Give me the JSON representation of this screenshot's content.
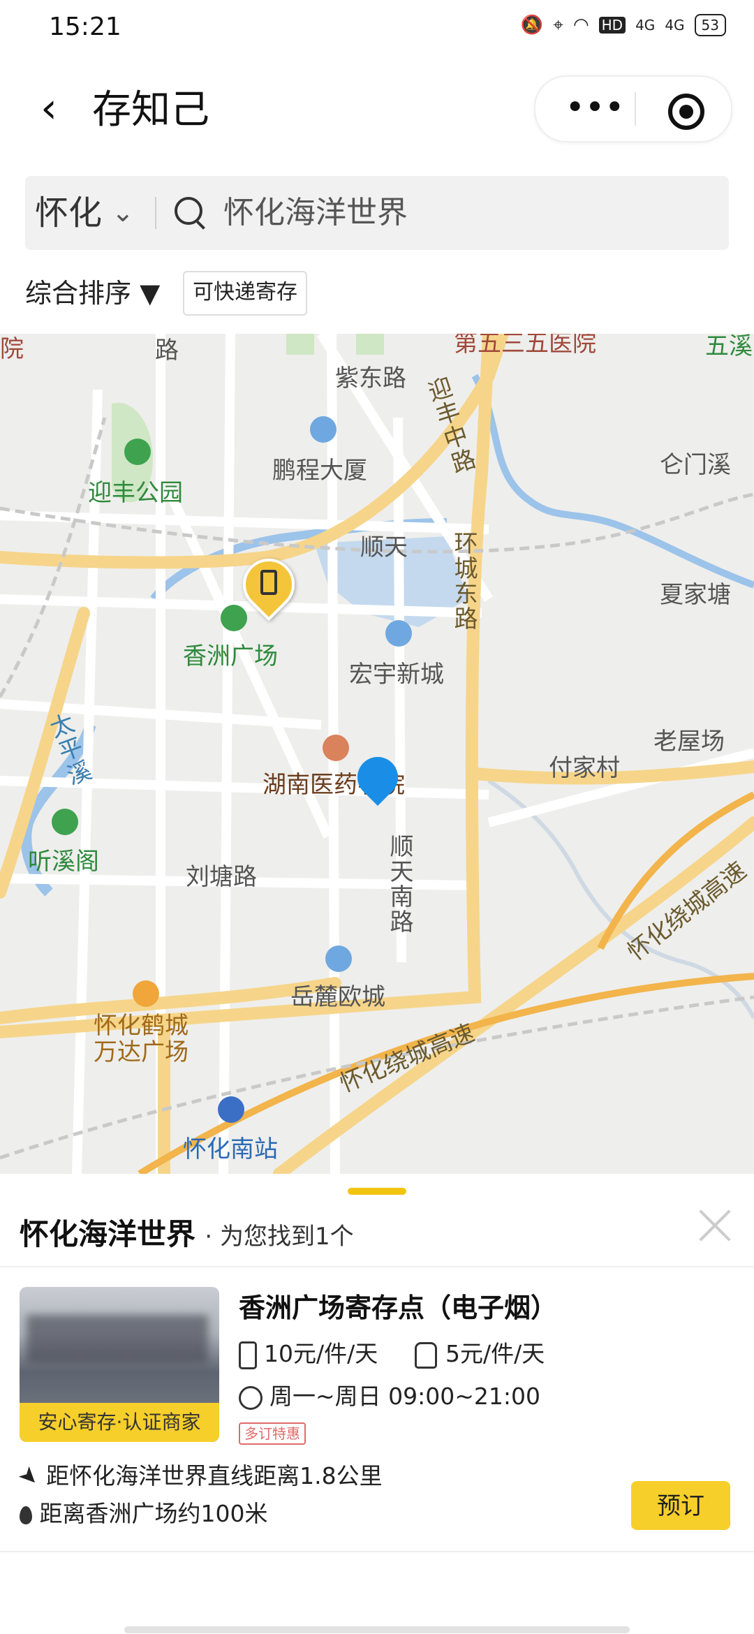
{
  "status_bar": {
    "time": "15:21",
    "net1": "4G",
    "net2": "4G",
    "hd": "HD",
    "battery": "53"
  },
  "header": {
    "back": "‹",
    "title": "存知己",
    "more": "•••"
  },
  "search": {
    "city": "怀化",
    "query": "怀化海洋世界"
  },
  "filters": {
    "sort_label": "综合排序 ▼",
    "tag": "可快递寄存"
  },
  "map": {
    "labels": {
      "zidong_road": "紫东路",
      "pengcheng": "鹏程大厦",
      "yingfeng_park": "迎丰公园",
      "shuntian": "顺天",
      "xiangzhou_square": "香洲广场",
      "hongyu": "宏宇新城",
      "yingfeng_mid_road": "迎丰中路",
      "huancheng_east": "环城东路",
      "cangmenxi": "仑门溪",
      "xiajiatang": "夏家塘",
      "laowuchang": "老屋场",
      "fujiacun": "付家村",
      "hospital": "湖南医药学院",
      "taipingxi": "太平溪",
      "tingxige": "听溪阁",
      "liutang_road": "刘塘路",
      "shuntian_south": "顺天南路",
      "yuelu": "岳麓欧城",
      "wanda": "怀化鹤城万达广场",
      "south_station": "怀化南站",
      "ring_hw1": "怀化绕城高速",
      "ring_hw2": "怀化绕城高速",
      "top_hospital": "第五三五医院",
      "top_road": "路",
      "top_left": "院",
      "top_right": "五溪"
    }
  },
  "sheet": {
    "keyword": "怀化海洋世界",
    "found_text": "· 为您找到1个",
    "shop": {
      "name": "香洲广场寄存点（电子烟）",
      "badge": "安心寄存·认证商家",
      "price_luggage": "10元/件/天",
      "price_bag": "5元/件/天",
      "hours": "周一~周日 09:00~21:00",
      "promo": "多订特惠",
      "distance_line": "距怀化海洋世界直线距离1.8公里",
      "near_line": "距离香洲广场约100米",
      "book_label": "预订"
    }
  }
}
